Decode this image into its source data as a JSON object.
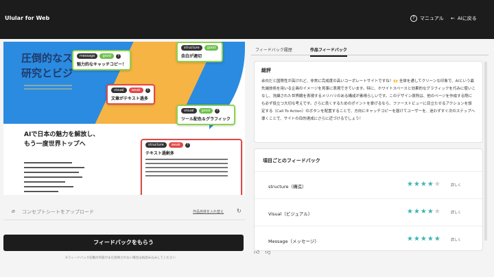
{
  "header": {
    "app_title": "Ulular for Web",
    "manual_label": "マニュアル",
    "back_label": "AIに戻る"
  },
  "preview": {
    "hero_title": "圧倒的なス\n研究とビジ",
    "catch": "AIで日本の魅力を解放し、\nもう一度世界トップへ",
    "cards": [
      {
        "tag": "message",
        "rating": "good",
        "text": "魅力的なキャッチコピー！"
      },
      {
        "tag": "structure",
        "rating": "good",
        "text": "余白が適切"
      },
      {
        "tag": "visual",
        "rating": "weak",
        "text": "文章がテキスト過多"
      },
      {
        "tag": "visual",
        "rating": "good",
        "text": "ツール配色＆グラフィック"
      },
      {
        "tag": "structure",
        "rating": "weak",
        "text": "テキスト過剰多"
      }
    ]
  },
  "upload": {
    "placeholder": "コンセプトシートをアップロード",
    "link": "作品自体を入れ替え"
  },
  "submit_label": "フィードバックをもらう",
  "footnote": "※フィードバック記載の内容がまだ反映されない場合は再読み込みしてください",
  "tabs": [
    {
      "label": "フィードバック履歴",
      "active": false
    },
    {
      "label": "作品フィードバック",
      "active": true
    }
  ],
  "summary": {
    "title": "総評",
    "text": "余白だと国際性が高けれど、非常に完成度の高いコーポレートサイトですね！🙌 全体を通してクリーンな印象で、AIという最先端技術を用いる企画のイメージを見事に表現できています。特に、ホワイトスペースと効果的なグラフィックを巧みに使いこなし、洗練された世界観を表現するメリハリのある構成が素晴らしいです。このデザイン原則は、他のページを作成する際にも必ず役立つ大切な考えです。さらに良くするためのポイントを挙げるなら、ファーストビューに目立たせるアクションを設定する（Call To Action）のボタンを配置することで、方向にキャッチコピーを届けてユーザーを、迷わずすぐ次のステップへ導くことで、サイトの目的達成にさらに近づけるでしょう！"
  },
  "items": {
    "title": "項目ごとのフィードバック",
    "rows": [
      {
        "name": "structure（構造）",
        "stars": 4,
        "detail": "詳しく"
      },
      {
        "name": "Visual（ビジュアル）",
        "stars": 4,
        "detail": "詳しく"
      },
      {
        "name": "Message（メッセージ）",
        "stars": 5,
        "detail": "詳しく"
      }
    ]
  }
}
